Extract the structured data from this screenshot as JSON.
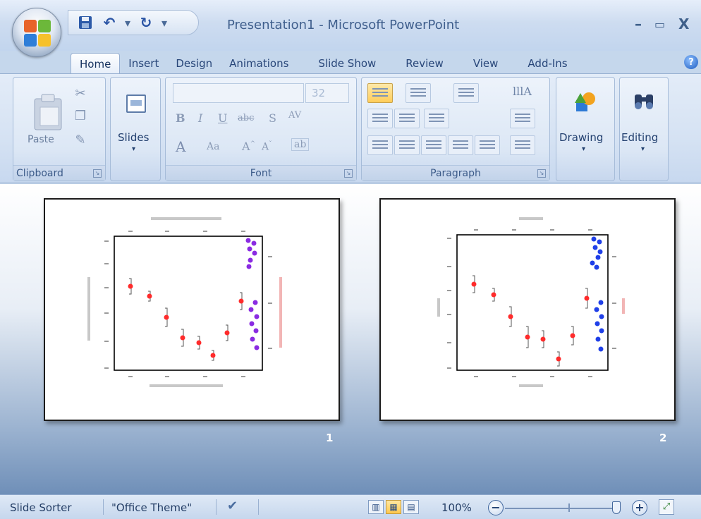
{
  "window": {
    "title": "Presentation1 - Microsoft PowerPoint",
    "minimize": "–",
    "maximize": "▭",
    "close": "X"
  },
  "ribbon": {
    "tabs": [
      "Home",
      "Insert",
      "Design",
      "Animations",
      "Slide Show",
      "Review",
      "View",
      "Add-Ins"
    ],
    "active_tab": "Home",
    "clipboard": {
      "label": "Clipboard",
      "paste": "Paste"
    },
    "slides": {
      "label": "Slides"
    },
    "font": {
      "label": "Font",
      "size": "32"
    },
    "paragraph": {
      "label": "Paragraph"
    },
    "drawing": {
      "label": "Drawing"
    },
    "editing": {
      "label": "Editing"
    }
  },
  "sorter": {
    "slides": [
      {
        "number": "1"
      },
      {
        "number": "2"
      }
    ]
  },
  "status": {
    "view": "Slide Sorter",
    "theme": "\"Office Theme\"",
    "zoom": "100%"
  },
  "colors": {
    "ribbon": "#d5e2f3",
    "accent": "#ffcd5a",
    "point_red": "#ff2b2b",
    "point_purple_slide1": "#8a2be2",
    "point_blue_slide2": "#1f3fe8"
  }
}
